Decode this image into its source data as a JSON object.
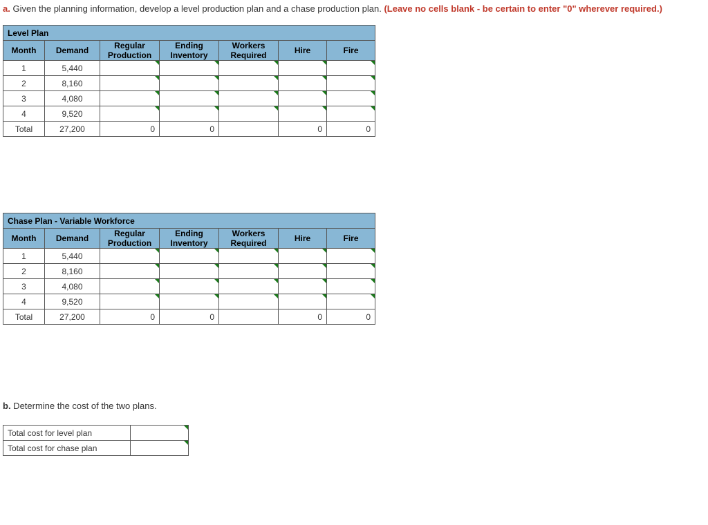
{
  "partA": {
    "lead": "a.",
    "text": " Given the planning information, develop a level production plan and a chase production plan. ",
    "instruction": "(Leave no cells blank - be certain to enter \"0\" wherever required.)"
  },
  "headers": {
    "month": "Month",
    "demand": "Demand",
    "regprod": "Regular Production",
    "endinv": "Ending Inventory",
    "workers": "Workers Required",
    "hire": "Hire",
    "fire": "Fire"
  },
  "level": {
    "title": "Level Plan",
    "rows": [
      {
        "month": "1",
        "demand": "5,440"
      },
      {
        "month": "2",
        "demand": "8,160"
      },
      {
        "month": "3",
        "demand": "4,080"
      },
      {
        "month": "4",
        "demand": "9,520"
      }
    ],
    "total": {
      "label": "Total",
      "demand": "27,200",
      "regprod": "0",
      "endinv": "0",
      "hire": "0",
      "fire": "0"
    }
  },
  "chase": {
    "title": "Chase Plan - Variable Workforce",
    "rows": [
      {
        "month": "1",
        "demand": "5,440"
      },
      {
        "month": "2",
        "demand": "8,160"
      },
      {
        "month": "3",
        "demand": "4,080"
      },
      {
        "month": "4",
        "demand": "9,520"
      }
    ],
    "total": {
      "label": "Total",
      "demand": "27,200",
      "regprod": "0",
      "endinv": "0",
      "hire": "0",
      "fire": "0"
    }
  },
  "partB": {
    "lead": "b.",
    "text": " Determine the cost of the two plans."
  },
  "cost": {
    "levelLabel": "Total cost for level plan",
    "chaseLabel": "Total cost for chase plan"
  }
}
